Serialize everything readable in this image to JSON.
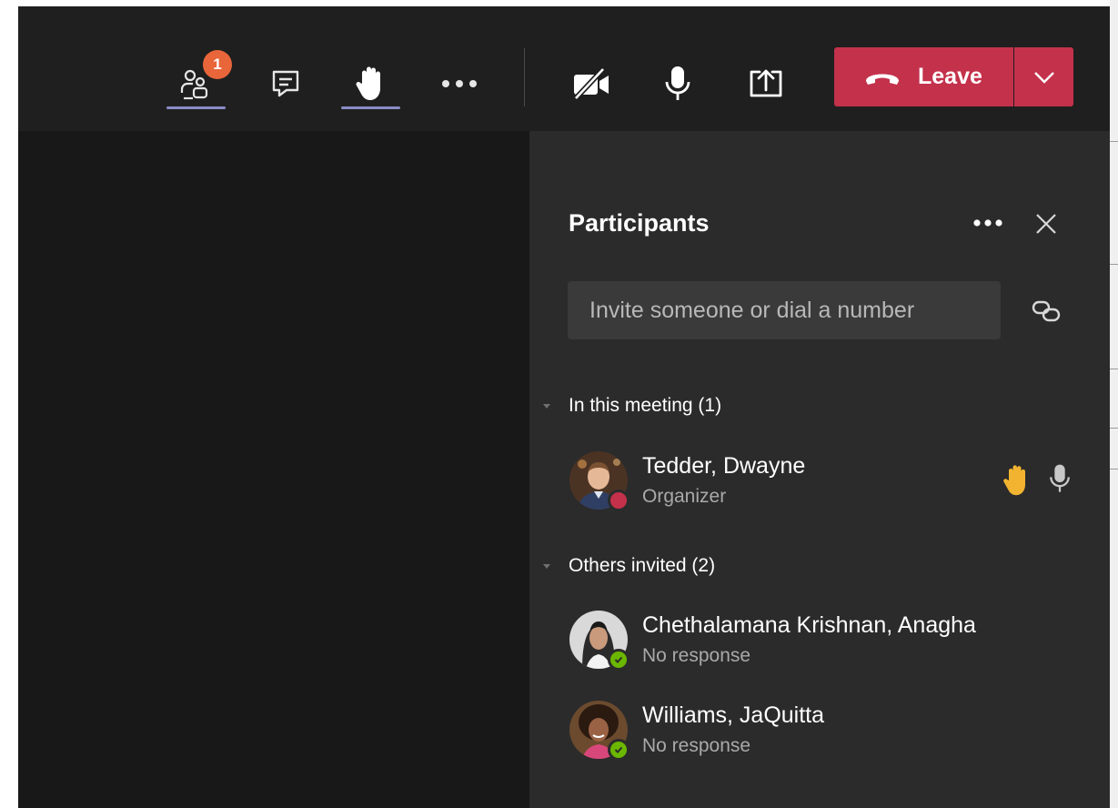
{
  "toolbar": {
    "participants_badge": "1",
    "leave_label": "Leave",
    "icons": {
      "participants": "people-icon",
      "chat": "chat-icon",
      "raise_hand": "hand-icon",
      "more": "more-options-icon",
      "camera": "camera-off-icon",
      "microphone": "microphone-icon",
      "share": "share-screen-icon",
      "leave": "phone-hangup-icon",
      "leave_options": "chevron-down-icon"
    }
  },
  "panel": {
    "title": "Participants",
    "invite_placeholder": "Invite someone or dial a number",
    "sections": [
      {
        "title": "In this meeting (1)",
        "people": [
          {
            "name": "Tedder, Dwayne",
            "role": "Organizer",
            "status": "busy",
            "hand_raised": true
          }
        ]
      },
      {
        "title": "Others invited (2)",
        "people": [
          {
            "name": "Chethalamana Krishnan, Anagha",
            "role": "No response",
            "status": "available"
          },
          {
            "name": "Williams, JaQuitta",
            "role": "No response",
            "status": "available"
          }
        ]
      }
    ]
  },
  "colors": {
    "toolbar_bg": "#1f1f1f",
    "stage_bg": "#181818",
    "panel_bg": "#2b2b2b",
    "leave_red": "#c4314b",
    "badge_orange": "#e8663a",
    "active_underline": "#8b8cc7",
    "busy_red": "#c4314b",
    "available_green": "#6bb700",
    "raised_hand_yellow": "#f2b430"
  }
}
